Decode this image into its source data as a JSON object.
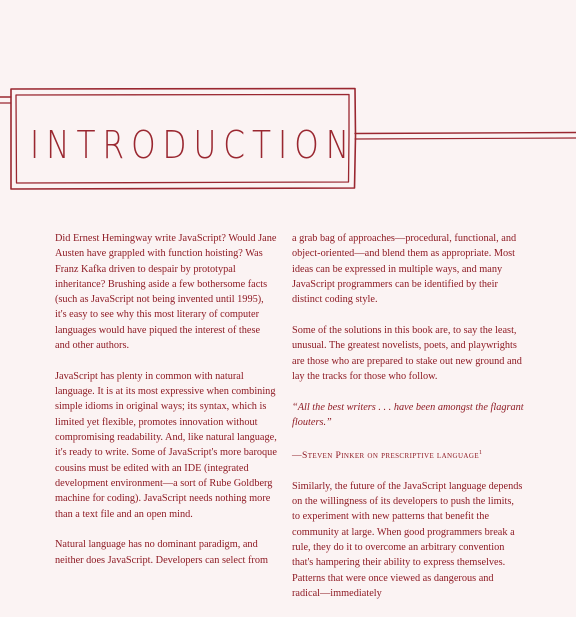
{
  "chapter": {
    "title": "INTRODUCTION"
  },
  "left_column": {
    "paragraphs": [
      "Did Ernest Hemingway write JavaScript? Would Jane Austen have grappled with function hoisting? Was Franz Kafka driven to despair by prototypal inheritance? Brushing aside a few bothersome facts (such as JavaScript not being invented until 1995), it's easy to see why this most literary of computer languages would have piqued the interest of these and other authors.",
      "JavaScript has plenty in common with natural language. It is at its most expressive when combining simple idioms in original ways; its syntax, which is limited yet flexible, promotes innovation without compromising readability. And, like natural language, it's ready to write. Some of JavaScript's more baroque cousins must be edited with an IDE (integrated development environment—a sort of Rube Goldberg machine for coding). JavaScript needs nothing more than a text file and an open mind.",
      "Natural language has no dominant paradigm, and neither does JavaScript. Developers can select from"
    ]
  },
  "right_column": {
    "paragraphs": [
      "a grab bag of approaches—procedural, functional, and object-oriented—and blend them as appropriate. Most ideas can be expressed in multiple ways, and many JavaScript programmers can be identified by their distinct coding style.",
      "Some of the solutions in this book are, to say the least, unusual. The greatest novelists, poets, and playwrights are those who are prepared to stake out new ground and lay the tracks for those who follow."
    ],
    "quote": "“All the best writers . . . have been amongst the flagrant flouters.”",
    "attribution": "—Steven Pinker on prescriptive language",
    "footnote_marker": "1",
    "closing_paragraph": "Similarly, the future of the JavaScript language depends on the willingness of its developers to push the limits, to experiment with new patterns that benefit the community at large. When good programmers break a rule, they do it to overcome an arbitrary convention that's hampering their ability to express themselves. Patterns that were once viewed as dangerous and radical—immediately"
  },
  "colors": {
    "accent": "#9a2730",
    "text": "#8e1b24",
    "background": "#fbf3f3"
  }
}
